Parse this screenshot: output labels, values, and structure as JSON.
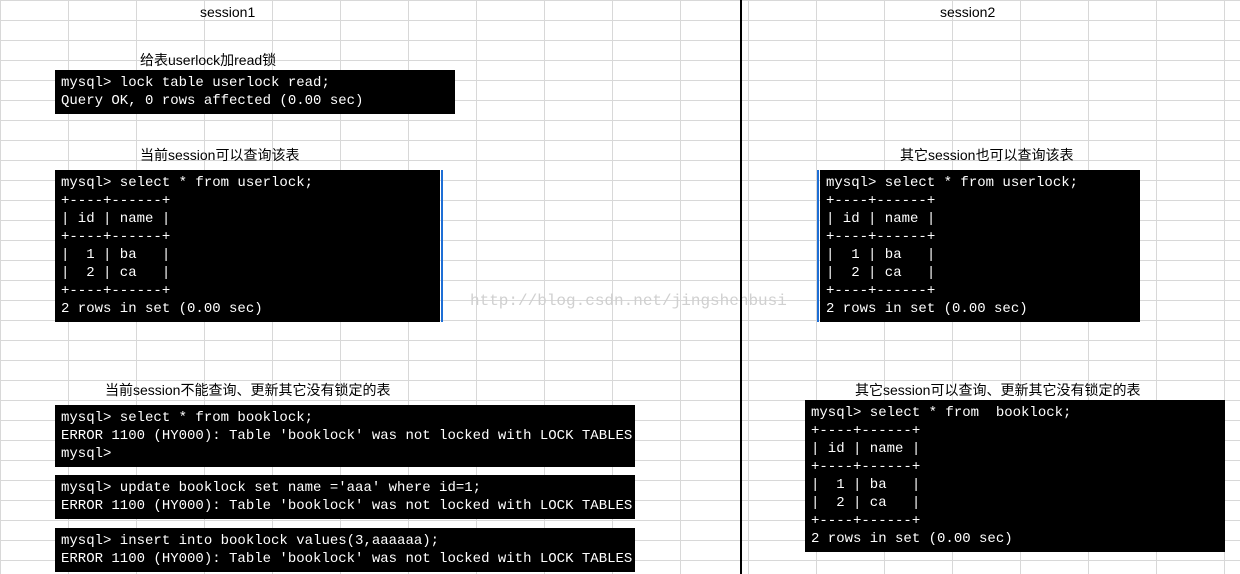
{
  "headers": {
    "session1": "session1",
    "session2": "session2"
  },
  "labels": {
    "s1_lock": "给表userlock加read锁",
    "s1_query": "当前session可以查询该表",
    "s1_other": "当前session不能查询、更新其它没有锁定的表",
    "s2_query": "其它session也可以查询该表",
    "s2_other": "其它session可以查询、更新其它没有锁定的表"
  },
  "terminals": {
    "s1_t1": "mysql> lock table userlock read;\nQuery OK, 0 rows affected (0.00 sec)",
    "s1_t2": "mysql> select * from userlock;\n+----+------+\n| id | name |\n+----+------+\n|  1 | ba   |\n|  2 | ca   |\n+----+------+\n2 rows in set (0.00 sec)",
    "s1_t3a": "mysql> select * from booklock;\nERROR 1100 (HY000): Table 'booklock' was not locked with LOCK TABLES\nmysql>",
    "s1_t3b": "mysql> update booklock set name ='aaa' where id=1;\nERROR 1100 (HY000): Table 'booklock' was not locked with LOCK TABLES",
    "s1_t3c": "mysql> insert into booklock values(3,aaaaaa);\nERROR 1100 (HY000): Table 'booklock' was not locked with LOCK TABLES",
    "s2_t1": "mysql> select * from userlock;\n+----+------+\n| id | name |\n+----+------+\n|  1 | ba   |\n|  2 | ca   |\n+----+------+\n2 rows in set (0.00 sec)",
    "s2_t2": "mysql> select * from  booklock;\n+----+------+\n| id | name |\n+----+------+\n|  1 | ba   |\n|  2 | ca   |\n+----+------+\n2 rows in set (0.00 sec)"
  },
  "watermark": "http://blog.csdn.net/jingshenbusi"
}
